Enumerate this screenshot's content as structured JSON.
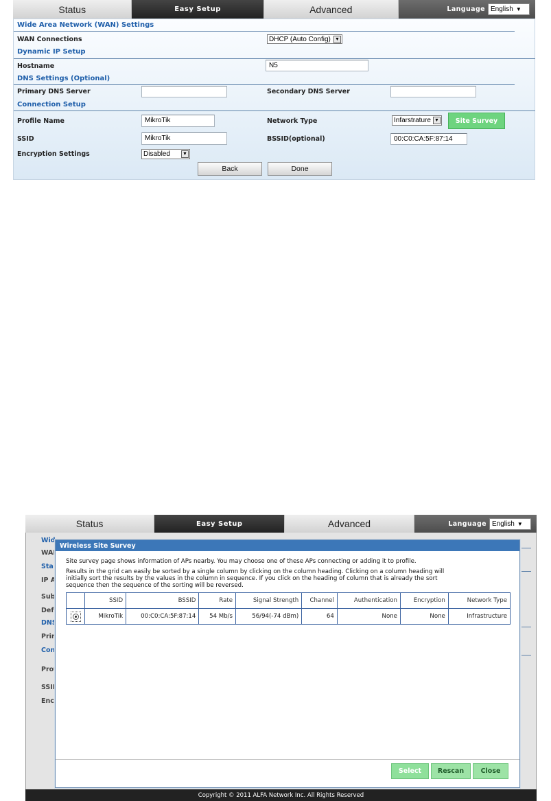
{
  "nav": {
    "status": "Status",
    "easy_setup": "Easy Setup",
    "advanced": "Advanced",
    "language_label": "Language",
    "language_value": "English"
  },
  "screen1": {
    "sections": {
      "wan": "Wide Area Network (WAN) Settings",
      "dynamic": "Dynamic IP Setup",
      "dns": "DNS Settings (Optional)",
      "connection": "Connection Setup"
    },
    "wan_connections_label": "WAN Connections",
    "wan_connections_value": "DHCP (Auto Config)",
    "hostname_label": "Hostname",
    "hostname_value": "N5",
    "primary_dns_label": "Primary DNS Server",
    "primary_dns_value": "",
    "secondary_dns_label": "Secondary DNS Server",
    "secondary_dns_value": "",
    "profile_name_label": "Profile Name",
    "profile_name_value": "MikroTik",
    "network_type_label": "Network Type",
    "network_type_value": "Infarstrature",
    "site_survey_button": "Site Survey",
    "ssid_label": "SSID",
    "ssid_value": "MikroTik",
    "bssid_label": "BSSID(optional)",
    "bssid_value": "00:C0:CA:5F:87:14",
    "encryption_label": "Encryption Settings",
    "encryption_value": "Disabled",
    "back_button": "Back",
    "done_button": "Done"
  },
  "screen2": {
    "background_fragments": [
      "Wid",
      "WAI",
      "Sta",
      "IP A",
      "Sub",
      "Defa",
      "DNS",
      "Prin",
      "Con",
      "Profi",
      "SSII",
      "Enc"
    ],
    "dialog": {
      "title": "Wireless Site Survey",
      "intro": "Site survey page shows information of APs nearby. You may choose one of these APs connecting or adding it to profile.",
      "sort_help_1": "Results in the grid can easily be sorted by a single column by clicking on the column heading. Clicking on a column heading will",
      "sort_help_2": "initially sort the results by the values in the column in sequence. If you click on the heading of column that is already the sort",
      "sort_help_3": "sequence then the sequence of the sorting will be reversed.",
      "columns": [
        "SSID",
        "BSSID",
        "Rate",
        "Signal Strength",
        "Channel",
        "Authentication",
        "Encryption",
        "Network Type"
      ],
      "rows": [
        {
          "ssid": "MikroTik",
          "bssid": "00:C0:CA:5F:87:14",
          "rate": "54 Mb/s",
          "signal": "56/94(-74 dBm)",
          "channel": "64",
          "auth": "None",
          "encryption": "None",
          "network_type": "Infrastructure"
        }
      ],
      "select_button": "Select",
      "rescan_button": "Rescan",
      "close_button": "Close"
    },
    "footer": "Copyright © 2011 ALFA Network Inc. All Rights Reserved"
  }
}
